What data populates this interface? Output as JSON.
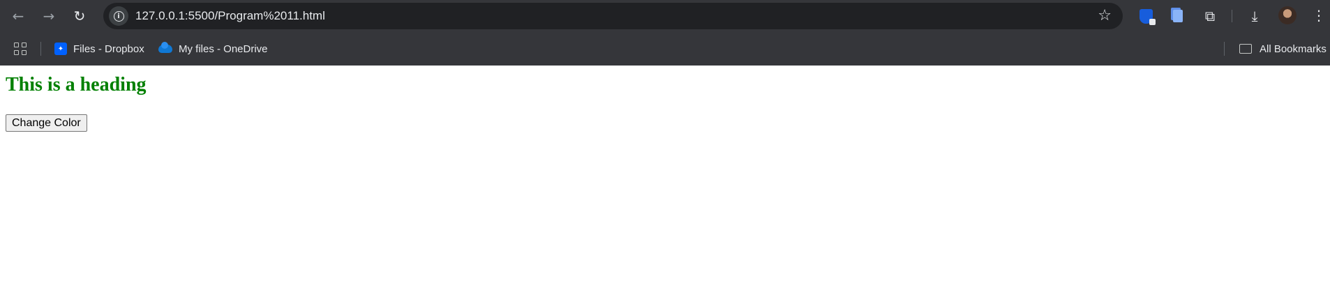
{
  "browser": {
    "url": "127.0.0.1:5500/Program%2011.html",
    "nav": {
      "back_icon": "arrow-left",
      "forward_icon": "arrow-right",
      "reload_icon": "reload"
    },
    "bookmarks": [
      {
        "label": "Files - Dropbox",
        "icon": "dropbox-icon"
      },
      {
        "label": "My files - OneDrive",
        "icon": "onedrive-icon"
      }
    ],
    "all_bookmarks_label": "All Bookmarks",
    "colors": {
      "frame": "#35363a",
      "omnibox": "#202124",
      "text": "#e8eaed"
    }
  },
  "page": {
    "heading": "This is a heading",
    "heading_color": "#008000",
    "button_label": "Change Color"
  }
}
